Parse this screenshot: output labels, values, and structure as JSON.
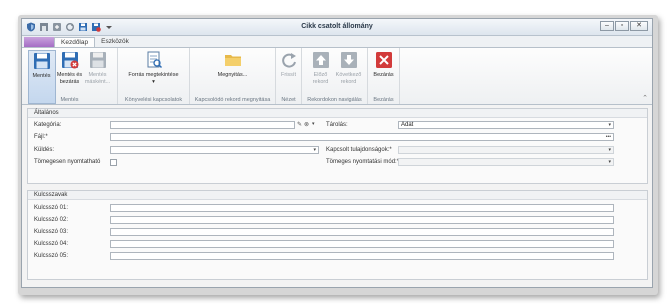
{
  "window": {
    "title": "Cikk csatolt állomány"
  },
  "tabs": {
    "home": "Kezdőlap",
    "tools": "Eszközök"
  },
  "ribbon": {
    "save": "Mentés",
    "save_close": "Mentés és bezárás",
    "save_as": "Mentés másként...",
    "group_save": "Mentés",
    "source": "Forrás megtekintése",
    "group_accounting": "Könyvelési kapcsolatok",
    "open": "Megnyitás...",
    "group_linked": "Kapcsolódó rekord megnyitása",
    "refresh": "Frissít",
    "group_view": "Nézet",
    "prev": "Előző rekord",
    "next": "Következő rekord",
    "group_nav": "Rekordokon navigálás",
    "close": "Bezárás",
    "group_close": "Bezárás"
  },
  "general": {
    "header": "Általános",
    "category_label": "Kategória:",
    "category_value": "",
    "storage_label": "Tárolás:",
    "storage_value": "Adat",
    "file_label": "Fájl:*",
    "file_value": "",
    "send_label": "Küldés:",
    "send_value": "",
    "linked_props_label": "Kapcsolt tulajdonságok:*",
    "bulk_print_label": "Tömegesen nyomtatható",
    "bulk_print_mode_label": "Tömeges nyomtatási mód:*"
  },
  "keywords": {
    "header": "Kulcsszavak",
    "items": [
      "Kulcsszó 01:",
      "Kulcsszó 02:",
      "Kulcsszó 03:",
      "Kulcsszó 04:",
      "Kulcsszó 05:"
    ]
  },
  "colors": {
    "accent": "#2f6db4",
    "close_red": "#d23b3b",
    "purple_file_tab": "#a46dc4"
  }
}
